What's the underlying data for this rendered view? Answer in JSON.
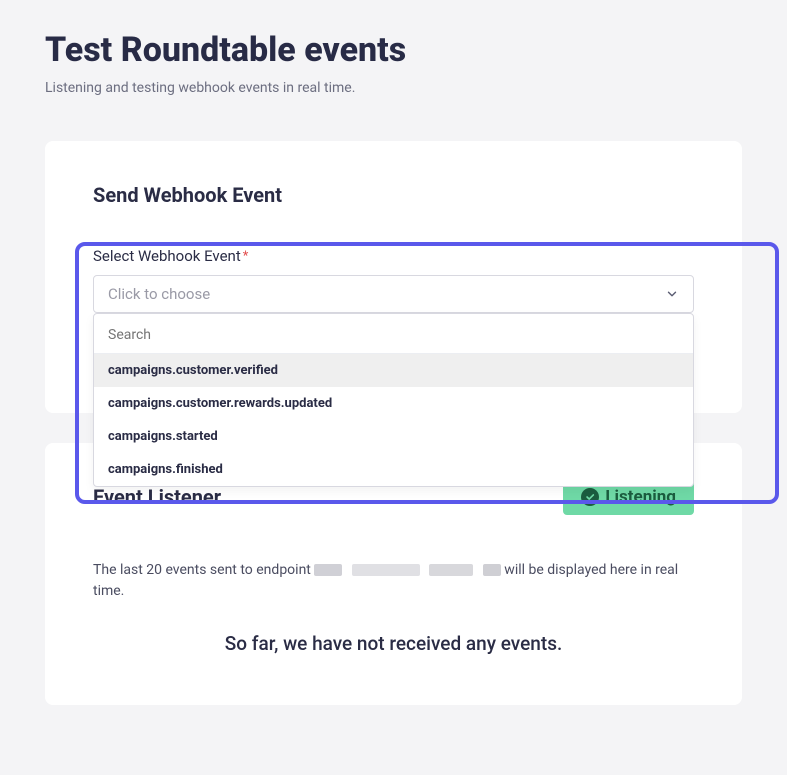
{
  "page": {
    "title": "Test Roundtable events",
    "subtitle": "Listening and testing webhook events in real time."
  },
  "send": {
    "title": "Send Webhook Event",
    "field_label": "Select Webhook Event",
    "required_marker": "*",
    "select_placeholder": "Click to choose",
    "search_placeholder": "Search",
    "options": [
      "campaigns.customer.verified",
      "campaigns.customer.rewards.updated",
      "campaigns.started",
      "campaigns.finished"
    ]
  },
  "listener": {
    "title": "Event Listener",
    "badge": "Listening",
    "desc_prefix": "The last 20 events sent to endpoint ",
    "desc_suffix": " will be displayed here in real time.",
    "empty": "So far, we have not received any events."
  }
}
